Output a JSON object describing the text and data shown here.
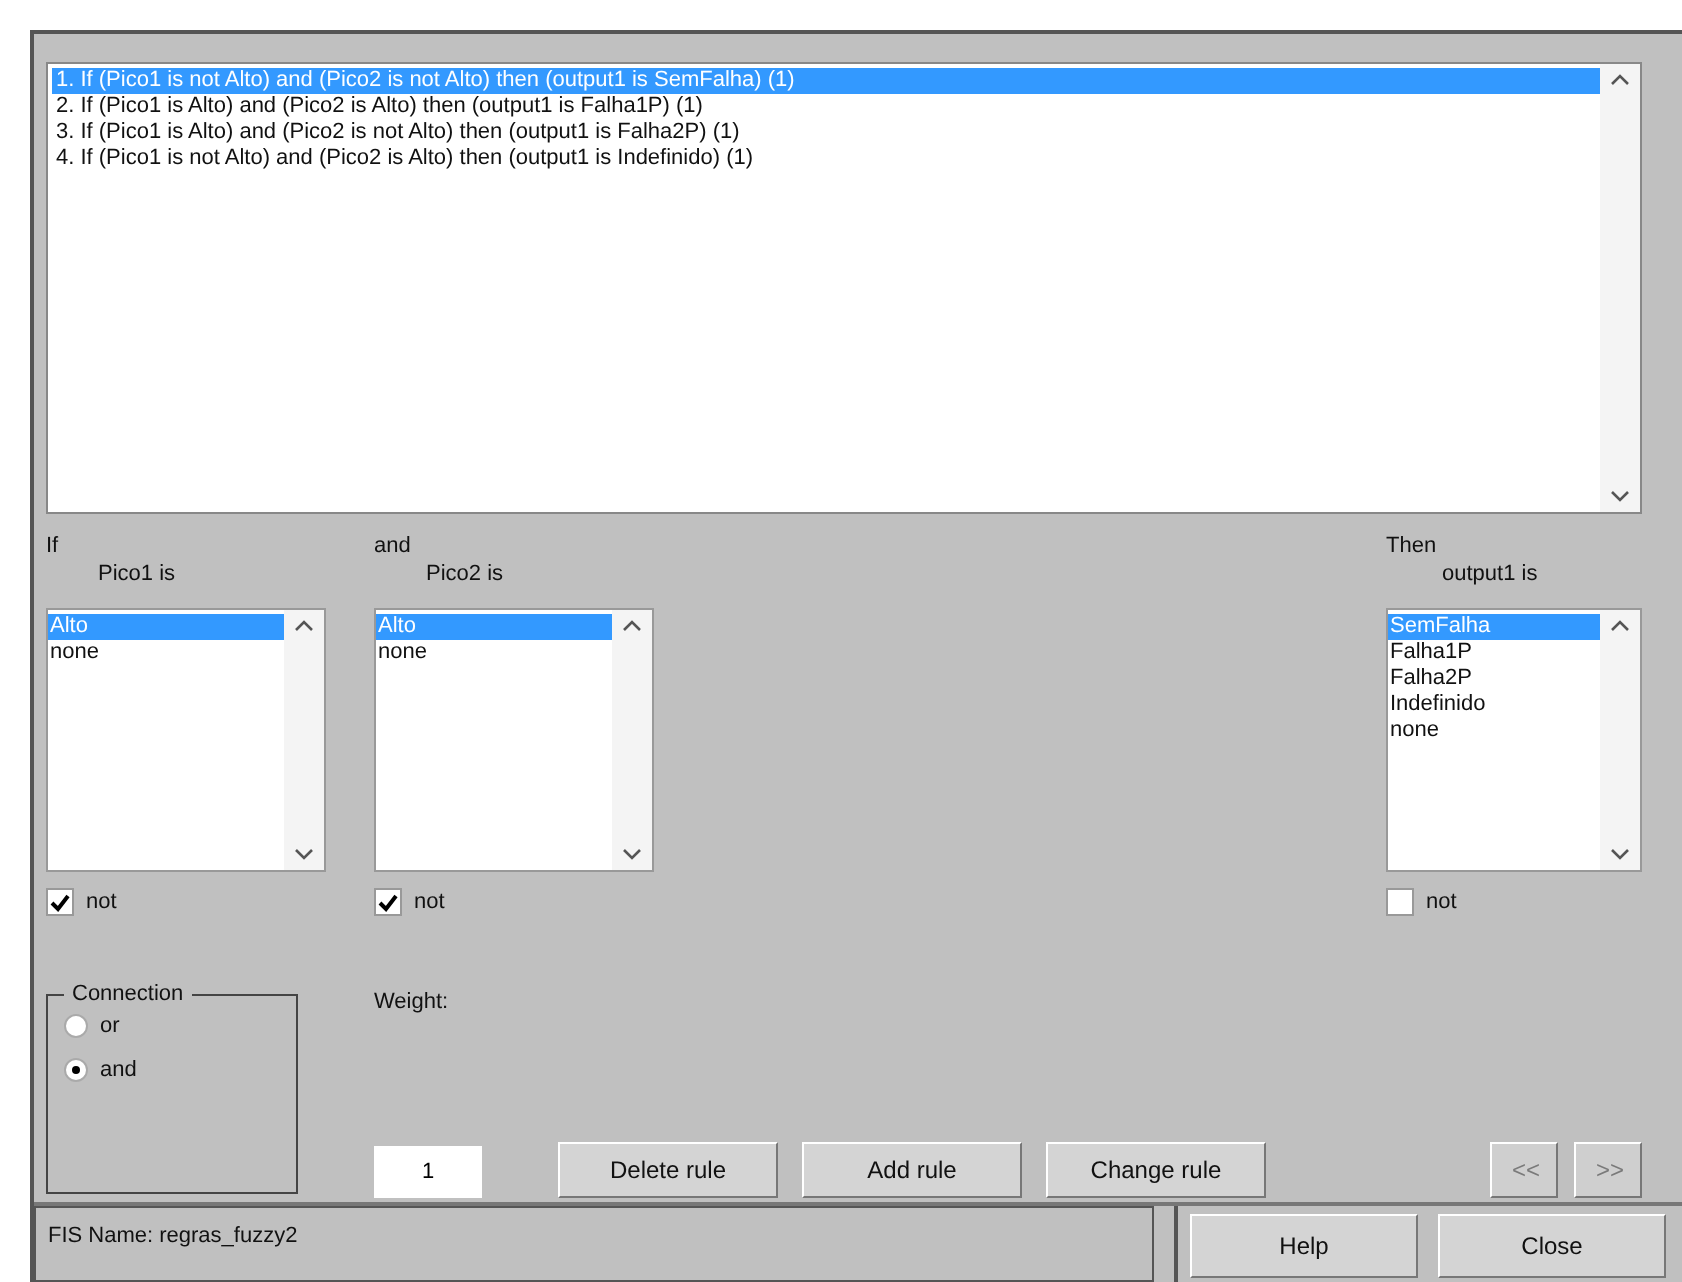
{
  "rules": [
    {
      "text": "1. If (Pico1 is not Alto) and (Pico2 is not Alto) then (output1 is SemFalha) (1)",
      "selected": true
    },
    {
      "text": "2. If (Pico1 is Alto) and (Pico2 is Alto) then (output1 is Falha1P) (1)",
      "selected": false
    },
    {
      "text": "3. If (Pico1 is Alto) and (Pico2 is not Alto) then (output1 is Falha2P) (1)",
      "selected": false
    },
    {
      "text": "4. If (Pico1 is not Alto) and (Pico2 is Alto) then (output1 is Indefinido) (1)",
      "selected": false
    }
  ],
  "variables": [
    {
      "connective": "If",
      "label": "Pico1 is",
      "items": [
        {
          "label": "Alto",
          "selected": true
        },
        {
          "label": "none",
          "selected": false
        }
      ],
      "not_label": "not",
      "not_checked": true
    },
    {
      "connective": "and",
      "label": "Pico2 is",
      "items": [
        {
          "label": "Alto",
          "selected": true
        },
        {
          "label": "none",
          "selected": false
        }
      ],
      "not_label": "not",
      "not_checked": true
    },
    {
      "connective": "Then",
      "label": "output1 is",
      "items": [
        {
          "label": "SemFalha",
          "selected": true
        },
        {
          "label": "Falha1P",
          "selected": false
        },
        {
          "label": "Falha2P",
          "selected": false
        },
        {
          "label": "Indefinido",
          "selected": false
        },
        {
          "label": "none",
          "selected": false
        }
      ],
      "not_label": "not",
      "not_checked": false
    }
  ],
  "connection": {
    "title": "Connection",
    "options": [
      {
        "label": "or",
        "selected": false
      },
      {
        "label": "and",
        "selected": true
      }
    ]
  },
  "weight": {
    "label": "Weight:",
    "value": "1"
  },
  "rule_buttons": [
    {
      "label": "Delete rule",
      "disabled": false
    },
    {
      "label": "Add rule",
      "disabled": false
    },
    {
      "label": "Change rule",
      "disabled": false
    }
  ],
  "nav_buttons": [
    {
      "label": "<<",
      "disabled": true
    },
    {
      "label": ">>",
      "disabled": true
    }
  ],
  "status_bar": {
    "text": "FIS Name: regras_fuzzy2"
  },
  "footer_buttons": [
    {
      "label": "Help"
    },
    {
      "label": "Close"
    }
  ]
}
